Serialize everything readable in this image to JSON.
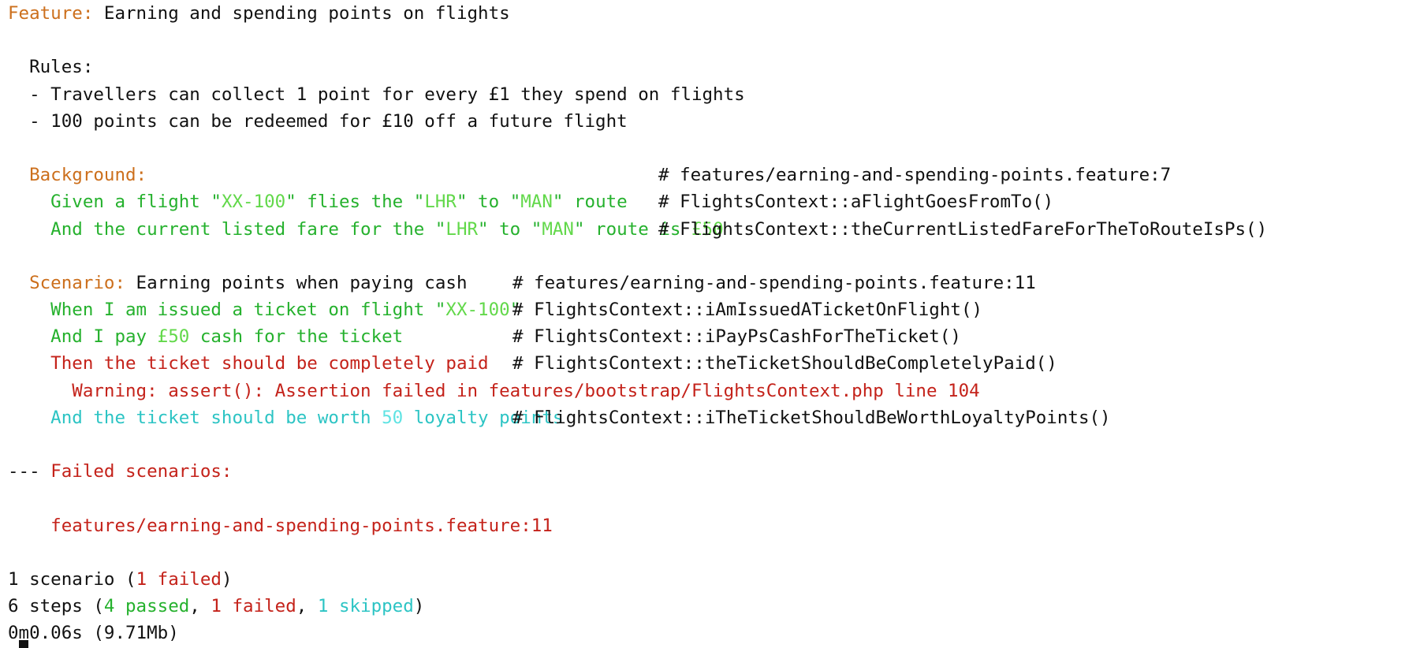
{
  "feature": {
    "keyword": "Feature:",
    "title": " Earning and spending points on flights"
  },
  "rules": {
    "header": "  Rules:",
    "items": [
      "  - Travellers can collect 1 point for every £1 they spend on flights",
      "  - 100 points can be redeemed for £10 off a future flight"
    ]
  },
  "background": {
    "keyword": "  Background:",
    "location": "# features/earning-and-spending-points.feature:7",
    "step1": {
      "p1": "    Given a flight \"",
      "a1": "XX-100",
      "p2": "\" flies the \"",
      "a2": "LHR",
      "p3": "\" to \"",
      "a3": "MAN",
      "p4": "\" route",
      "def": "# FlightsContext::aFlightGoesFromTo()"
    },
    "step2": {
      "p1": "    And the current listed fare for the \"",
      "a1": "LHR",
      "p2": "\" to \"",
      "a2": "MAN",
      "p3": "\" route is ",
      "a3": "£50",
      "def": "# FlightsContext::theCurrentListedFareForTheToRouteIsPs()"
    }
  },
  "scenario": {
    "keyword": "  Scenario:",
    "title": " Earning points when paying cash",
    "location": "# features/earning-and-spending-points.feature:11",
    "step1": {
      "p1": "    When I am issued a ticket on flight \"",
      "a1": "XX-100",
      "p2": "\"",
      "def": "# FlightsContext::iAmIssuedATicketOnFlight()"
    },
    "step2": {
      "p1": "    And I pay ",
      "a1": "£50",
      "p2": " cash for the ticket",
      "def": "# FlightsContext::iPayPsCashForTheTicket()"
    },
    "step3": {
      "text": "    Then the ticket should be completely paid",
      "def": "# FlightsContext::theTicketShouldBeCompletelyPaid()"
    },
    "warning": "      Warning: assert(): Assertion failed in features/bootstrap/FlightsContext.php line 104",
    "step4": {
      "p1": "    And the ticket should be worth ",
      "a1": "50",
      "p2": " loyalty points",
      "def": "# FlightsContext::iTheTicketShouldBeWorthLoyaltyPoints()"
    }
  },
  "failed": {
    "dashes": "--- ",
    "label": "Failed scenarios:",
    "path": "    features/earning-and-spending-points.feature:11"
  },
  "summary": {
    "scen_pre": "1 scenario (",
    "scen_failed": "1 failed",
    "scen_post": ")",
    "steps_pre": "6 steps (",
    "steps_passed": "4 passed",
    "sep1": ", ",
    "steps_failed": "1 failed",
    "sep2": ", ",
    "steps_skipped": "1 skipped",
    "steps_post": ")",
    "time": "0m0.06s (9.71Mb)"
  },
  "colors": {
    "keyword": "#cc6f1c",
    "passed": "#25b12d",
    "passed_arg": "#62d84a",
    "failed": "#c4221a",
    "skipped": "#2cc4c4",
    "skipped_arg": "#5fe3e3",
    "text": "#111111",
    "background": "#ffffff"
  }
}
